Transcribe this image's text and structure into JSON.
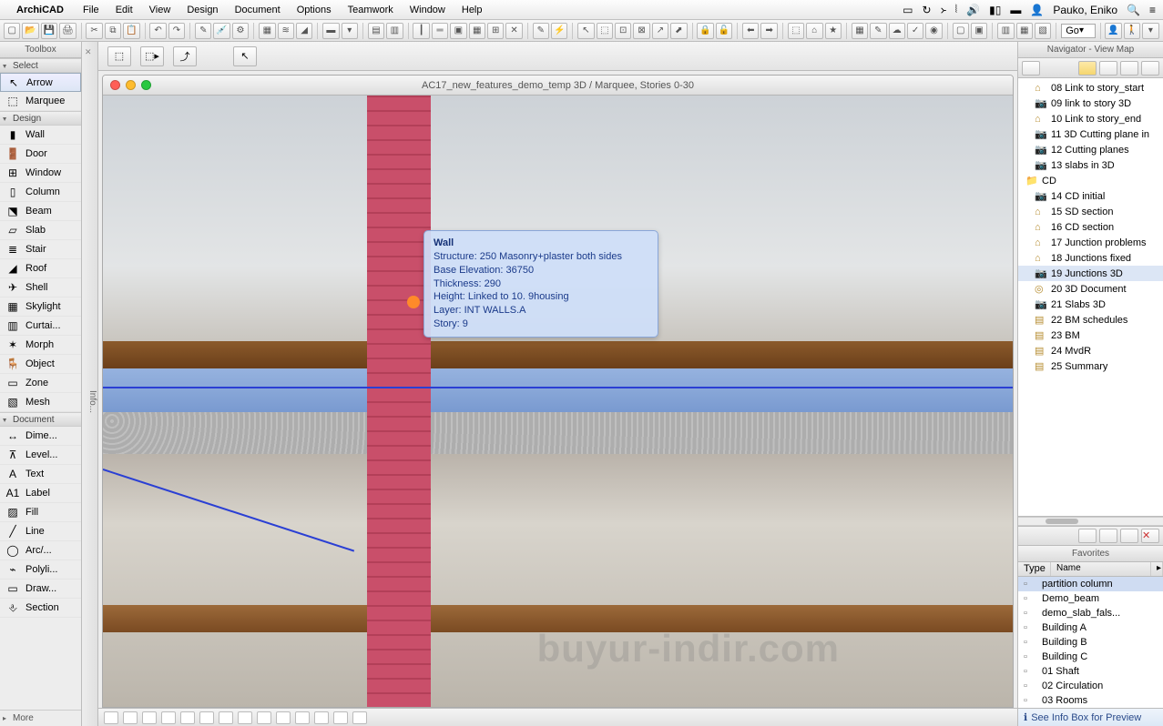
{
  "menubar": {
    "app": "ArchiCAD",
    "items": [
      "File",
      "Edit",
      "View",
      "Design",
      "Document",
      "Options",
      "Teamwork",
      "Window",
      "Help"
    ],
    "user": "Pauko, Eniko"
  },
  "toolbox": {
    "title": "Toolbox",
    "select_hdr": "Select",
    "design_hdr": "Design",
    "document_hdr": "Document",
    "more": "More",
    "select_tools": [
      {
        "label": "Arrow",
        "icon": "↖"
      },
      {
        "label": "Marquee",
        "icon": "⬚"
      }
    ],
    "design_tools": [
      {
        "label": "Wall",
        "icon": "▮"
      },
      {
        "label": "Door",
        "icon": "🚪"
      },
      {
        "label": "Window",
        "icon": "⊞"
      },
      {
        "label": "Column",
        "icon": "▯"
      },
      {
        "label": "Beam",
        "icon": "⬔"
      },
      {
        "label": "Slab",
        "icon": "▱"
      },
      {
        "label": "Stair",
        "icon": "≣"
      },
      {
        "label": "Roof",
        "icon": "◢"
      },
      {
        "label": "Shell",
        "icon": "✈"
      },
      {
        "label": "Skylight",
        "icon": "▦"
      },
      {
        "label": "Curtai...",
        "icon": "▥"
      },
      {
        "label": "Morph",
        "icon": "✶"
      },
      {
        "label": "Object",
        "icon": "🪑"
      },
      {
        "label": "Zone",
        "icon": "▭"
      },
      {
        "label": "Mesh",
        "icon": "▧"
      }
    ],
    "document_tools": [
      {
        "label": "Dime...",
        "icon": "↔"
      },
      {
        "label": "Level...",
        "icon": "⊼"
      },
      {
        "label": "Text",
        "icon": "A"
      },
      {
        "label": "Label",
        "icon": "A1"
      },
      {
        "label": "Fill",
        "icon": "▨"
      },
      {
        "label": "Line",
        "icon": "╱"
      },
      {
        "label": "Arc/...",
        "icon": "◯"
      },
      {
        "label": "Polyli...",
        "icon": "⌁"
      },
      {
        "label": "Draw...",
        "icon": "▭"
      },
      {
        "label": "Section",
        "icon": "⎀"
      }
    ]
  },
  "info_tab": "Info...",
  "window": {
    "title": "AC17_new_features_demo_temp 3D / Marquee, Stories 0-30"
  },
  "tooltip": {
    "title": "Wall",
    "lines": {
      "structure": "Structure: 250 Masonry+plaster both sides",
      "base": "Base Elevation: 36750",
      "thickness": "Thickness: 290",
      "height": "Height: Linked to 10. 9housing",
      "layer": "Layer: INT WALLS.A",
      "story": "Story: 9"
    }
  },
  "navigator": {
    "title": "Navigator - View Map",
    "items": [
      {
        "icon": "⌂",
        "label": "08 Link to story_start",
        "sub": true
      },
      {
        "icon": "📷",
        "label": "09 link to story 3D",
        "sub": true
      },
      {
        "icon": "⌂",
        "label": "10 Link to story_end",
        "sub": true
      },
      {
        "icon": "📷",
        "label": "11 3D Cutting plane in",
        "sub": true
      },
      {
        "icon": "📷",
        "label": "12 Cutting planes",
        "sub": true
      },
      {
        "icon": "📷",
        "label": "13 slabs in 3D",
        "sub": true
      },
      {
        "icon": "📁",
        "label": "CD",
        "sub": false
      },
      {
        "icon": "📷",
        "label": "14 CD initial",
        "sub": true
      },
      {
        "icon": "⌂",
        "label": "15 SD section",
        "sub": true
      },
      {
        "icon": "⌂",
        "label": "16 CD section",
        "sub": true
      },
      {
        "icon": "⌂",
        "label": "17 Junction problems",
        "sub": true
      },
      {
        "icon": "⌂",
        "label": "18 Junctions fixed",
        "sub": true
      },
      {
        "icon": "📷",
        "label": "19 Junctions 3D",
        "sub": true,
        "selected": true
      },
      {
        "icon": "◎",
        "label": "20 3D Document",
        "sub": true
      },
      {
        "icon": "📷",
        "label": "21 Slabs 3D",
        "sub": true
      },
      {
        "icon": "▤",
        "label": "22 BM schedules",
        "sub": true
      },
      {
        "icon": "▤",
        "label": "23 BM",
        "sub": true
      },
      {
        "icon": "▤",
        "label": "24 MvdR",
        "sub": true
      },
      {
        "icon": "▤",
        "label": "25 Summary",
        "sub": true
      }
    ]
  },
  "favorites": {
    "title": "Favorites",
    "col_type": "Type",
    "col_name": "Name",
    "items": [
      {
        "label": "partition column",
        "selected": true
      },
      {
        "label": "Demo_beam"
      },
      {
        "label": "demo_slab_fals..."
      },
      {
        "label": "Building A"
      },
      {
        "label": "Building B"
      },
      {
        "label": "Building C"
      },
      {
        "label": "01 Shaft"
      },
      {
        "label": "02 Circulation"
      },
      {
        "label": "03 Rooms"
      }
    ]
  },
  "hint": "See Info Box for Preview",
  "go_label": "Go",
  "watermark": "buyur-indir.com"
}
